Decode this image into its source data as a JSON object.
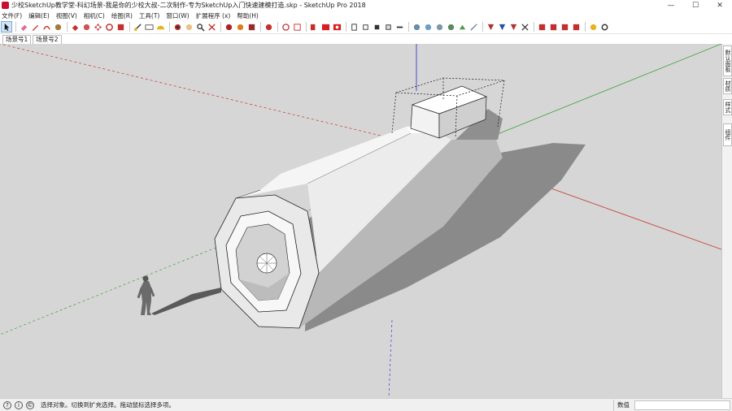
{
  "window": {
    "title": "少校SketchUp教学堂-科幻场景-我是你的少校大叔-二次制作-专为SketchUp入门快速建模打造.skp - SketchUp Pro 2018",
    "minimize": "—",
    "maximize": "☐",
    "close": "✕"
  },
  "menubar": {
    "items": [
      "文件(F)",
      "编辑(E)",
      "视图(V)",
      "相机(C)",
      "绘图(R)",
      "工具(T)",
      "窗口(W)",
      "扩展程序 (x)",
      "帮助(H)"
    ]
  },
  "toolbar": {
    "icons": [
      "select-arrow-icon",
      "eraser-icon",
      "pencil-icon",
      "arc-icon",
      "paint-bucket-icon",
      "push-pull-icon",
      "follow-me-icon",
      "move-icon",
      "rotate-icon",
      "scale-icon",
      "offset-icon",
      "tape-measure-icon",
      "text-icon",
      "protractor-icon",
      "axes-icon",
      "dimension-icon",
      "orbit-icon",
      "pan-icon",
      "zoom-icon",
      "zoom-extents-icon",
      "previous-view-icon",
      "warehouse-icon",
      "extension-warehouse-icon",
      "layout-icon",
      "component-icon",
      "solid-tools-icon",
      "section-plane-icon",
      "iso-view-icon",
      "top-view-icon",
      "front-view-icon",
      "right-view-icon",
      "back-view-icon",
      "left-view-icon",
      "xray-icon",
      "wireframe-icon",
      "hidden-line-icon",
      "shaded-icon",
      "textured-icon",
      "monochrome-icon",
      "sandbox-icon",
      "smoove-icon",
      "stamp-icon",
      "drape-icon",
      "add-detail-icon",
      "flip-edge-icon",
      "geo-location-icon",
      "shadow-icon"
    ]
  },
  "scenes": {
    "tabs": [
      "场景号1",
      "场景号2"
    ]
  },
  "tray": {
    "tabs": [
      "默认面板",
      "材质",
      "样式",
      "组件"
    ]
  },
  "statusbar": {
    "hint": "选择对象。切换到扩充选择。拖动鼠标选择多项。",
    "measurements_label": "数值",
    "measurements_value": ""
  },
  "colors": {
    "viewport_bg": "#d6d6d6",
    "axis_red": "#c8322d",
    "axis_green": "#3aa13a",
    "axis_blue": "#3a3ad0",
    "shadow": "#8a8a8a"
  }
}
